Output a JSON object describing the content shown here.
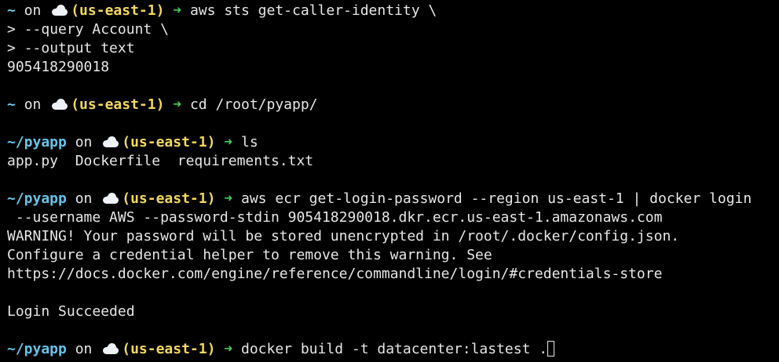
{
  "prompt": {
    "home": "~",
    "dir": "~/pyapp",
    "on": "on",
    "region": "(us-east-1)",
    "arrow": "➜",
    "continuation": ">"
  },
  "lines": {
    "l1_cmd": "aws sts get-caller-identity \\",
    "l2_cmd": "--query Account \\",
    "l3_cmd": "--output text",
    "l4_out": "905418290018",
    "l5_cmd": "cd /root/pyapp/",
    "l6_cmd": "ls",
    "l7_out": "app.py  Dockerfile  requirements.txt",
    "l8_cmd": "aws ecr get-login-password --region us-east-1 | docker login",
    "l9_wrap": " --username AWS --password-stdin 905418290018.dkr.ecr.us-east-1.amazonaws.com",
    "l10_out": "WARNING! Your password will be stored unencrypted in /root/.docker/config.json.",
    "l11_out": "Configure a credential helper to remove this warning. See",
    "l12_out": "https://docs.docker.com/engine/reference/commandline/login/#credentials-store",
    "l13_out": "Login Succeeded",
    "l14_cmd": "docker build -t datacenter:lastest ."
  },
  "colors": {
    "background": "#000000",
    "text": "#e6e6e6",
    "dir": "#63c5ea",
    "region": "#f2d85a",
    "arrow": "#3fd150"
  },
  "icons": {
    "cloud": "cloud-icon",
    "cursor": "text-cursor"
  }
}
